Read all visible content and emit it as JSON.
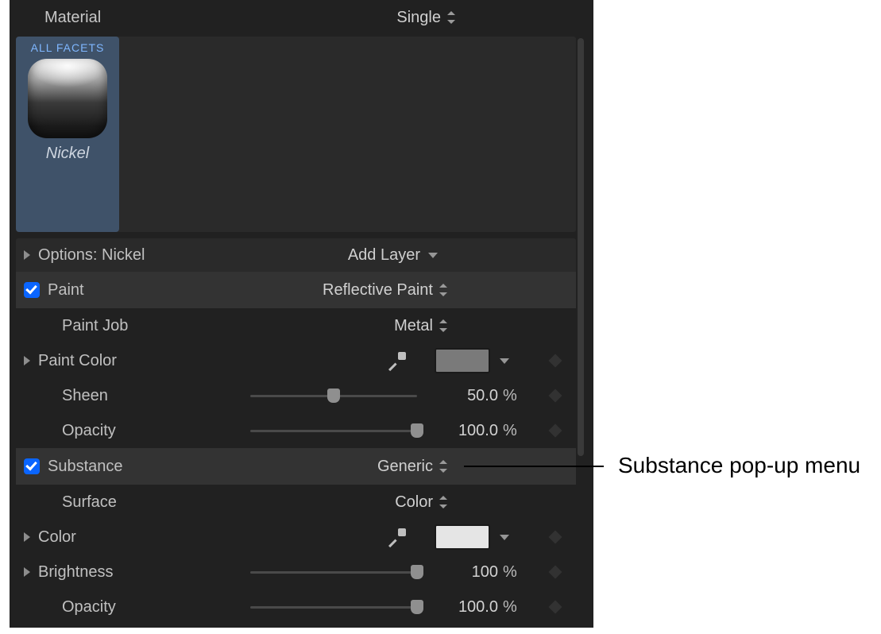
{
  "header": {
    "label": "Material",
    "value": "Single"
  },
  "facet": {
    "tab": "ALL FACETS",
    "name": "Nickel"
  },
  "options": {
    "label": "Options: Nickel",
    "add_layer": "Add Layer"
  },
  "paint": {
    "title": "Paint",
    "type": "Reflective Paint",
    "paint_job": {
      "label": "Paint Job",
      "value": "Metal"
    },
    "paint_color": {
      "label": "Paint Color",
      "swatch": "#7a7a7a"
    },
    "sheen": {
      "label": "Sheen",
      "value": "50.0",
      "unit": "%",
      "pct": 50
    },
    "opacity": {
      "label": "Opacity",
      "value": "100.0",
      "unit": "%",
      "pct": 100
    }
  },
  "substance": {
    "title": "Substance",
    "type": "Generic",
    "surface": {
      "label": "Surface",
      "value": "Color"
    },
    "color": {
      "label": "Color",
      "swatch": "#e5e5e5"
    },
    "brightness": {
      "label": "Brightness",
      "value": "100",
      "unit": "%",
      "pct": 100
    },
    "opacity": {
      "label": "Opacity",
      "value": "100.0",
      "unit": "%",
      "pct": 100
    }
  },
  "callout": "Substance pop-up menu"
}
